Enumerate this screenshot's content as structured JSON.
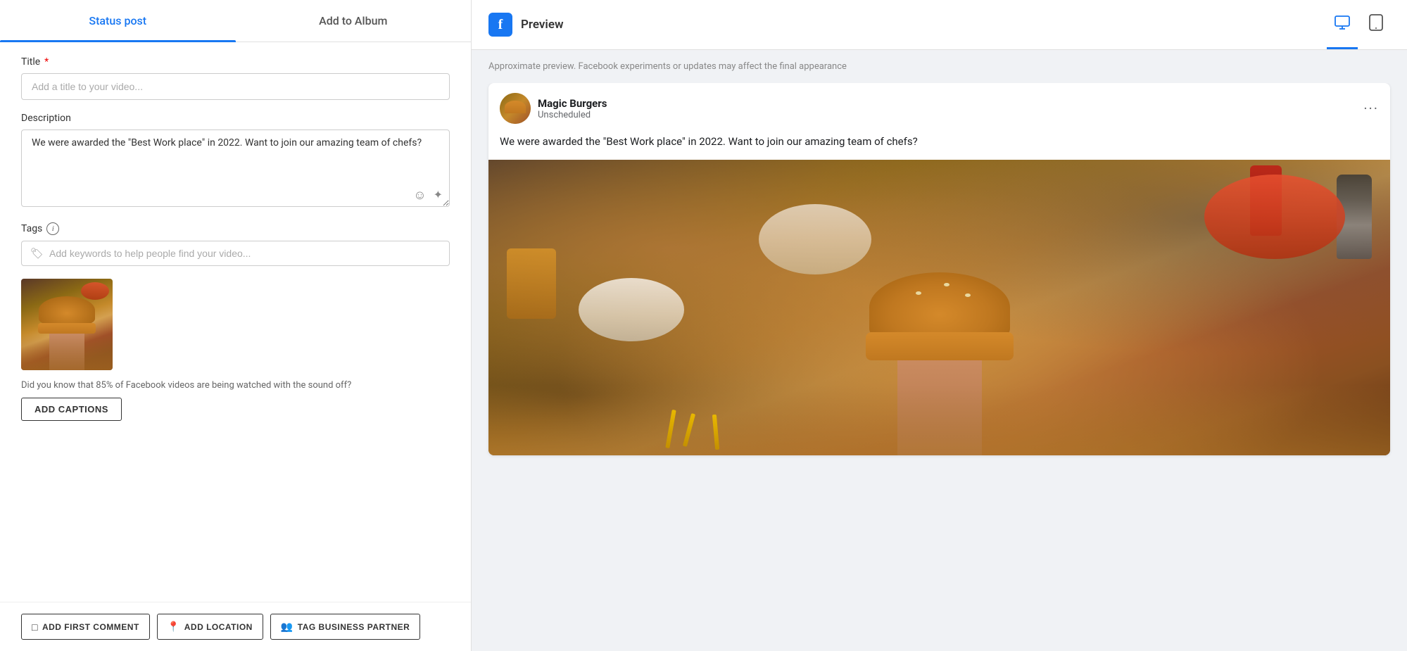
{
  "tabs": {
    "status_post": "Status post",
    "add_to_album": "Add to Album"
  },
  "form": {
    "title_label": "Title",
    "title_placeholder": "Add a title to your video...",
    "description_label": "Description",
    "description_value": "We were awarded the \"Best Work place\" in 2022. Want to join our amazing team of chefs?",
    "tags_label": "Tags",
    "tags_placeholder": "Add keywords to help people find your video...",
    "tip_text": "Did you know that 85% of Facebook videos are being watched with the sound off?",
    "add_captions_label": "ADD CAPTIONS"
  },
  "bottom_actions": {
    "add_first_comment": "ADD FIRST COMMENT",
    "add_location": "ADD LOCATION",
    "tag_business_partner": "TAG BUSINESS PARTNER"
  },
  "preview": {
    "title": "Preview",
    "note": "Approximate preview. Facebook experiments or updates may affect the final appearance",
    "author_name": "Magic Burgers",
    "author_status": "Unscheduled",
    "post_text": "We were awarded the \"Best Work place\" in 2022. Want to join our amazing team of chefs?"
  }
}
